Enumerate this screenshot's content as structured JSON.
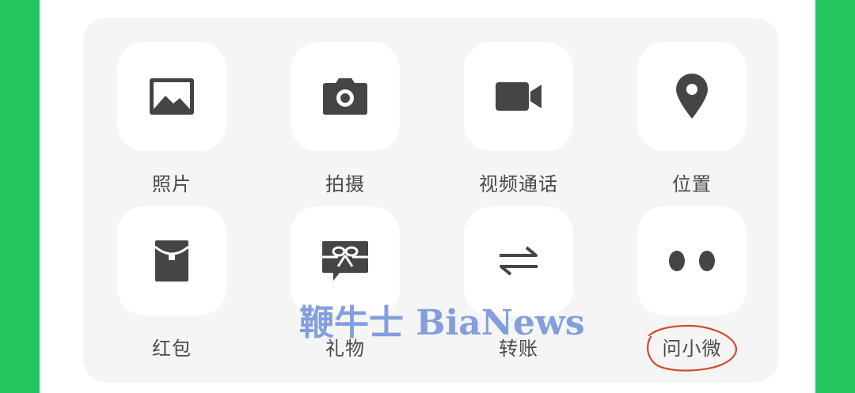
{
  "panel": {
    "items": [
      {
        "label": "照片",
        "icon": "image-icon"
      },
      {
        "label": "拍摄",
        "icon": "camera-icon"
      },
      {
        "label": "视频通话",
        "icon": "video-camera-icon"
      },
      {
        "label": "位置",
        "icon": "location-pin-icon"
      },
      {
        "label": "红包",
        "icon": "red-envelope-icon"
      },
      {
        "label": "礼物",
        "icon": "gift-icon"
      },
      {
        "label": "转账",
        "icon": "transfer-arrows-icon"
      },
      {
        "label": "问小微",
        "icon": "two-dots-icon"
      }
    ]
  },
  "watermark": "鞭牛士 BiaNews",
  "colors": {
    "side_background": "#22c55e",
    "panel_background": "#f5f5f5",
    "tile_background": "#ffffff",
    "icon_color": "#454545",
    "circle_annotation": "#d9482b"
  }
}
